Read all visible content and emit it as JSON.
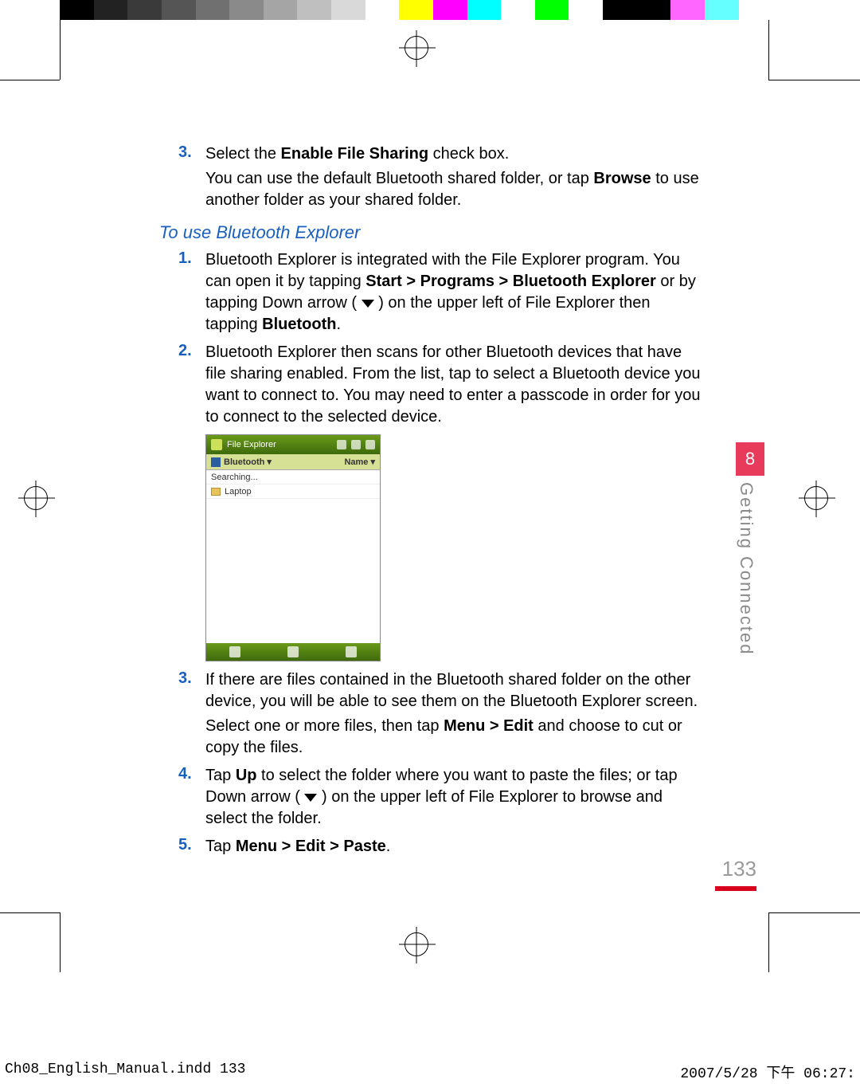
{
  "colorbar": [
    "#000000",
    "#222222",
    "#3a3a3a",
    "#555555",
    "#707070",
    "#8a8a8a",
    "#a5a5a5",
    "#bfbfbf",
    "#d9d9d9",
    "#ffffff",
    "#ffff00",
    "#ff00ff",
    "#00ffff",
    "#ffffff",
    "#00ff00",
    "#ffffff",
    "#000000",
    "#000000",
    "#ff66ff",
    "#66ffff",
    "#ffffff"
  ],
  "step3_top": {
    "num": "3.",
    "t1a": "Select the ",
    "t1b": "Enable File Sharing",
    "t1c": " check box.",
    "t2a": "You can use the default Bluetooth shared folder, or tap ",
    "t2b": "Browse",
    "t2c": " to use another folder as your shared folder."
  },
  "heading": "To use Bluetooth Explorer",
  "steps": [
    {
      "num": "1.",
      "parts": [
        "Bluetooth Explorer is integrated with the File Explorer program. You can open it by tapping ",
        "Start > Programs > Bluetooth Explorer",
        " or by tapping Down arrow ( ",
        " ) on the upper left of File Explorer then tapping ",
        "Bluetooth",
        "."
      ]
    },
    {
      "num": "2.",
      "parts": [
        "Bluetooth Explorer then scans for other Bluetooth devices that have file sharing enabled. From the list, tap to select a Bluetooth device you want to connect to. You may need to enter a passcode in order for you to connect to the selected device."
      ]
    }
  ],
  "screenshot": {
    "title": "File Explorer",
    "crumb_left": "Bluetooth",
    "crumb_right": "Name",
    "row_searching": "Searching...",
    "row_device": "Laptop"
  },
  "steps_after": [
    {
      "num": "3.",
      "line1": "If there are files contained in the Bluetooth shared folder on the other device, you will be able to see them on the Bluetooth Explorer screen.",
      "line2a": "Select one or more files, then tap ",
      "line2b": "Menu > Edit",
      "line2c": " and choose to cut or copy the files."
    },
    {
      "num": "4.",
      "t1": "Tap ",
      "t2": "Up",
      "t3": " to select the folder where you want to paste the files; or tap Down arrow ( ",
      "t4": " ) on the upper left of File Explorer to browse and select the folder."
    },
    {
      "num": "5.",
      "t1": "Tap ",
      "t2": "Menu > Edit > Paste",
      "t3": "."
    }
  ],
  "chapter_num": "8",
  "chapter_title": "Getting Connected",
  "page_num": "133",
  "footer_left": "Ch08_English_Manual.indd   133",
  "footer_right": "2007/5/28   下午 06:27:"
}
